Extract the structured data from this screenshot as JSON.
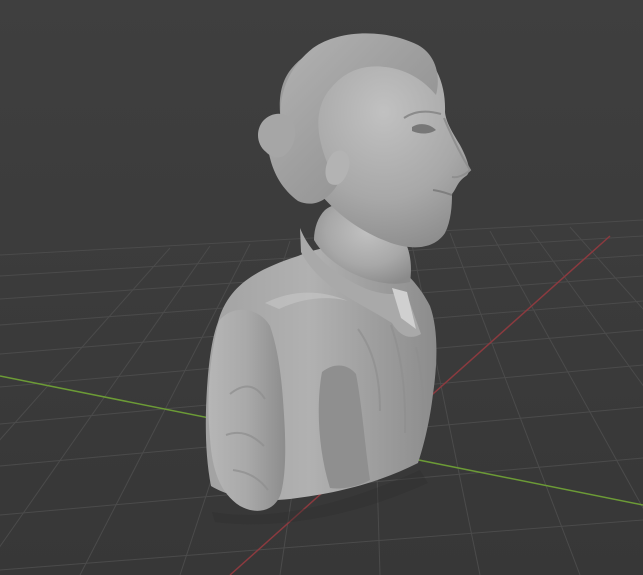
{
  "viewport": {
    "background_color": "#3d3d3d",
    "grid_line_color": "#4a4a4a",
    "x_axis_color": "#8b3a3f",
    "y_axis_color": "#6c9b36"
  },
  "model": {
    "object_name": "female-bust-sculpt",
    "material_color": "#a9a9a9"
  }
}
